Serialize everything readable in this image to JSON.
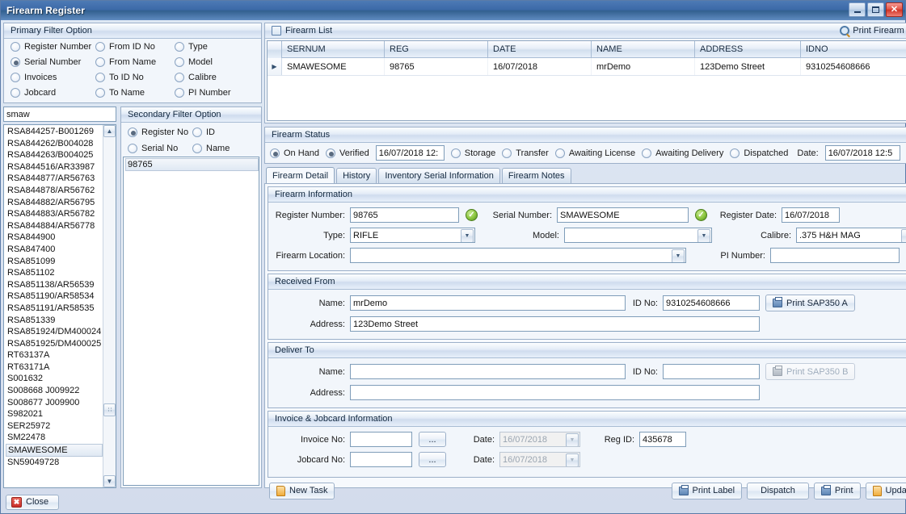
{
  "window": {
    "title": "Firearm Register",
    "minimize_label": "Minimize",
    "maximize_label": "Maximize",
    "close_label": "Close",
    "close_glyph": "✕"
  },
  "primary_filter": {
    "header": "Primary Filter Option",
    "options": [
      {
        "label": "Register Number",
        "selected": false
      },
      {
        "label": "From ID No",
        "selected": false
      },
      {
        "label": "Type",
        "selected": false
      },
      {
        "label": "Serial Number",
        "selected": true
      },
      {
        "label": "From Name",
        "selected": false
      },
      {
        "label": "Model",
        "selected": false
      },
      {
        "label": "Invoices",
        "selected": false
      },
      {
        "label": "To ID No",
        "selected": false
      },
      {
        "label": "Calibre",
        "selected": false
      },
      {
        "label": "Jobcard",
        "selected": false
      },
      {
        "label": "To Name",
        "selected": false
      },
      {
        "label": "PI Number",
        "selected": false
      }
    ],
    "search_value": "smaw",
    "search_placeholder": "",
    "results": [
      "RSA844257-B001269",
      "RSA844262/B004028",
      "RSA844263/B004025",
      "RSA844516/AR33987",
      "RSA844877/AR56763",
      "RSA844878/AR56762",
      "RSA844882/AR56795",
      "RSA844883/AR56782",
      "RSA844884/AR56778",
      "RSA844900",
      "RSA847400",
      "RSA851099",
      "RSA851102",
      "RSA851138/AR56539",
      "RSA851190/AR58534",
      "RSA851191/AR58535",
      "RSA851339",
      "RSA851924/DM400024",
      "RSA851925/DM400025",
      "RT63137A",
      "RT63171A",
      "S001632",
      "S008668 J009922",
      "S008677 J009900",
      "S982021",
      "SER25972",
      "SM22478",
      "SMAWESOME",
      "SN59049728"
    ],
    "selected_result": "SMAWESOME"
  },
  "secondary_filter": {
    "header": "Secondary Filter Option",
    "options": [
      {
        "label": "Register No",
        "selected": true
      },
      {
        "label": "ID",
        "selected": false
      },
      {
        "label": "Serial No",
        "selected": false
      },
      {
        "label": "Name",
        "selected": false
      }
    ],
    "results": [
      "98765"
    ],
    "selected_result": "98765"
  },
  "firearm_list": {
    "header": "Firearm List",
    "list_icon": "list-icon",
    "print_link": "Print Firearm List",
    "print_icon": "magnifier-icon",
    "columns": [
      "SERNUM",
      "REG",
      "DATE",
      "NAME",
      "ADDRESS",
      "IDNO"
    ],
    "rows": [
      {
        "marker": "▶",
        "SERNUM": "SMAWESOME",
        "REG": "98765",
        "DATE": "16/07/2018",
        "NAME": "mrDemo",
        "ADDRESS": "123Demo Street",
        "IDNO": "9310254608666"
      }
    ]
  },
  "firearm_status": {
    "header": "Firearm Status",
    "statuses": [
      {
        "label": "On Hand",
        "selected": true
      },
      {
        "label": "Verified",
        "selected": true
      }
    ],
    "verified_date": "16/07/2018 12:",
    "more_statuses": [
      {
        "label": "Storage",
        "selected": false
      },
      {
        "label": "Transfer",
        "selected": false
      },
      {
        "label": "Awaiting License",
        "selected": false
      },
      {
        "label": "Awaiting Delivery",
        "selected": false
      },
      {
        "label": "Dispatched",
        "selected": false
      }
    ],
    "date_label": "Date:",
    "date_value": "16/07/2018 12:5"
  },
  "tabs": [
    {
      "label": "Firearm Detail",
      "active": true
    },
    {
      "label": "History",
      "active": false
    },
    {
      "label": "Inventory Serial Information",
      "active": false
    },
    {
      "label": "Firearm Notes",
      "active": false
    }
  ],
  "firearm_information": {
    "header": "Firearm Information",
    "register_number_label": "Register Number:",
    "register_number_value": "98765",
    "register_number_valid_icon": "check-circle-icon",
    "serial_number_label": "Serial Number:",
    "serial_number_value": "SMAWESOME",
    "serial_number_valid_icon": "check-circle-icon",
    "register_date_label": "Register Date:",
    "register_date_value": "16/07/2018",
    "type_label": "Type:",
    "type_value": "RIFLE",
    "model_label": "Model:",
    "model_value": "",
    "calibre_label": "Calibre:",
    "calibre_value": ".375 H&H MAG",
    "firearm_location_label": "Firearm Location:",
    "firearm_location_value": "",
    "pi_number_label": "PI Number:",
    "pi_number_value": ""
  },
  "received_from": {
    "header": "Received From",
    "name_label": "Name:",
    "name_value": "mrDemo",
    "id_label": "ID No:",
    "id_value": "9310254608666",
    "address_label": "Address:",
    "address_value": "123Demo Street",
    "print_button": "Print SAP350 A",
    "print_icon": "printer-icon"
  },
  "deliver_to": {
    "header": "Deliver To",
    "name_label": "Name:",
    "name_value": "",
    "id_label": "ID No:",
    "id_value": "",
    "address_label": "Address:",
    "address_value": "",
    "print_button": "Print SAP350 B",
    "print_icon": "printer-icon",
    "print_disabled": true
  },
  "invoice_jobcard": {
    "header": "Invoice & Jobcard Information",
    "invoice_label": "Invoice No:",
    "invoice_value": "",
    "invoice_browse": "...",
    "invoice_date_label": "Date:",
    "invoice_date_value": "16/07/2018",
    "jobcard_label": "Jobcard No:",
    "jobcard_value": "",
    "jobcard_browse": "...",
    "jobcard_date_label": "Date:",
    "jobcard_date_value": "16/07/2018",
    "reg_id_label": "Reg ID:",
    "reg_id_value": "435678"
  },
  "action_bar": {
    "new_task": "New Task",
    "new_task_icon": "document-icon",
    "print_label": "Print Label",
    "print_label_icon": "printer-icon",
    "dispatch": "Dispatch",
    "print": "Print",
    "print_icon": "printer-icon",
    "update": "Update",
    "update_icon": "document-icon"
  },
  "footer": {
    "close": "Close",
    "close_icon": "close-x-icon"
  }
}
